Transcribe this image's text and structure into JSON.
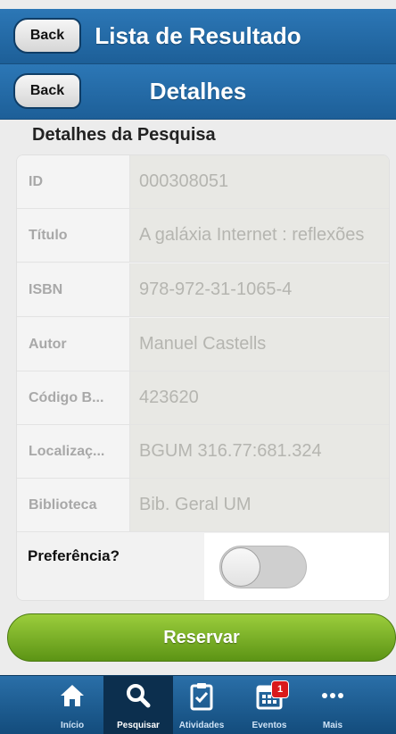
{
  "header1": {
    "back_label": "Back",
    "title": "Lista de Resultado"
  },
  "header2": {
    "back_label": "Back",
    "title": "Detalhes"
  },
  "section_title": "Detalhes da Pesquisa",
  "details": [
    {
      "label": "ID",
      "value": "000308051"
    },
    {
      "label": "Título",
      "value": "A galáxia Internet : reflexões"
    },
    {
      "label": "ISBN",
      "value": "978-972-31-1065-4"
    },
    {
      "label": "Autor",
      "value": "Manuel Castells"
    },
    {
      "label": "Código B...",
      "value": "423620"
    },
    {
      "label": "Localizaç...",
      "value": "BGUM 316.77:681.324"
    },
    {
      "label": "Biblioteca",
      "value": "Bib. Geral UM"
    }
  ],
  "preference": {
    "label": "Preferência?",
    "enabled": false
  },
  "reserve_label": "Reservar",
  "tabs": [
    {
      "label": "Início",
      "icon": "home-icon"
    },
    {
      "label": "Pesquisar",
      "icon": "search-icon"
    },
    {
      "label": "Atividades",
      "icon": "checklist-icon"
    },
    {
      "label": "Eventos",
      "icon": "calendar-icon",
      "badge": "1"
    },
    {
      "label": "Mais",
      "icon": "more-icon"
    }
  ],
  "active_tab": "Pesquisar",
  "colors": {
    "header": "#1f64a0",
    "reserve": "#7cb32a",
    "tabbar": "#1c5a8e",
    "badge": "#d9191b"
  }
}
